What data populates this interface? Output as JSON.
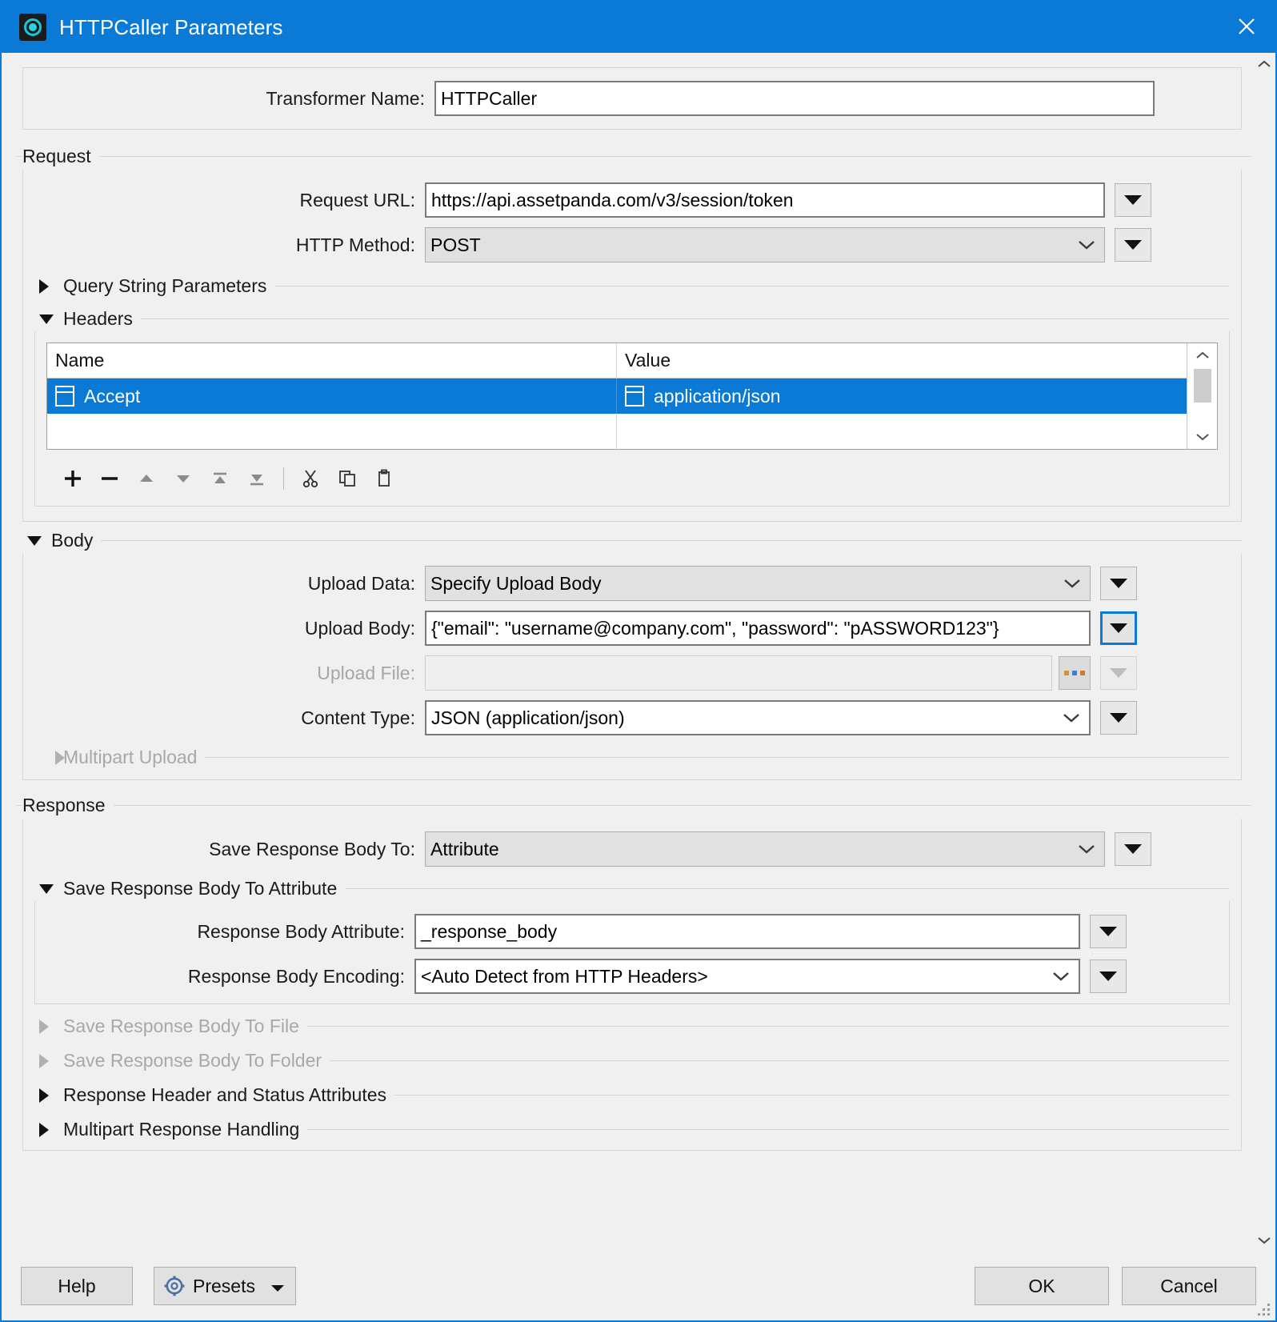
{
  "window": {
    "title": "HTTPCaller Parameters",
    "icon": "fme-transformer-icon",
    "close_icon": "close-icon"
  },
  "transformer": {
    "name_label": "Transformer Name:",
    "name_value": "HTTPCaller"
  },
  "request": {
    "group_label": "Request",
    "url_label": "Request URL:",
    "url_value": "https://api.assetpanda.com/v3/session/token",
    "method_label": "HTTP Method:",
    "method_value": "POST",
    "query_string_label": "Query String Parameters",
    "headers_label": "Headers",
    "headers_table": {
      "columns": [
        "Name",
        "Value"
      ],
      "rows": [
        {
          "name": "Accept",
          "value": "application/json",
          "selected": true
        }
      ]
    },
    "table_toolbar": [
      {
        "icon": "plus-icon",
        "name": "add-row-button"
      },
      {
        "icon": "minus-icon",
        "name": "remove-row-button"
      },
      {
        "icon": "arrow-up-icon",
        "name": "move-up-button"
      },
      {
        "icon": "arrow-down-icon",
        "name": "move-down-button"
      },
      {
        "icon": "move-to-top-icon",
        "name": "move-to-top-button"
      },
      {
        "icon": "move-to-bottom-icon",
        "name": "move-to-bottom-button"
      },
      {
        "icon": "cut-icon",
        "name": "cut-button"
      },
      {
        "icon": "copy-icon",
        "name": "copy-button"
      },
      {
        "icon": "paste-icon",
        "name": "paste-button"
      }
    ]
  },
  "body": {
    "section_label": "Body",
    "upload_data_label": "Upload Data:",
    "upload_data_value": "Specify Upload Body",
    "upload_body_label": "Upload Body:",
    "upload_body_value": "{\"email\": \"username@company.com\", \"password\": \"pASSWORD123\"}",
    "upload_file_label": "Upload File:",
    "upload_file_value": "",
    "browse_label": "...",
    "content_type_label": "Content Type:",
    "content_type_value": "JSON (application/json)",
    "multipart_upload_label": "Multipart Upload"
  },
  "response": {
    "group_label": "Response",
    "save_body_to_label": "Save Response Body To:",
    "save_body_to_value": "Attribute",
    "save_to_attribute_label": "Save Response Body To Attribute",
    "attribute_label": "Response Body Attribute:",
    "attribute_value": "_response_body",
    "encoding_label": "Response Body Encoding:",
    "encoding_value": "<Auto Detect from HTTP Headers>",
    "save_to_file_label": "Save Response Body To File",
    "save_to_folder_label": "Save Response Body To Folder",
    "header_status_label": "Response Header and Status Attributes",
    "multipart_response_label": "Multipart Response Handling"
  },
  "footer": {
    "help_label": "Help",
    "presets_label": "Presets",
    "ok_label": "OK",
    "cancel_label": "Cancel"
  },
  "colors": {
    "titlebar": "#0a7ad6",
    "selection": "#0a7ad6",
    "dialog_bg": "#f0f0f0",
    "icon_accent": "#2bd3e4"
  }
}
